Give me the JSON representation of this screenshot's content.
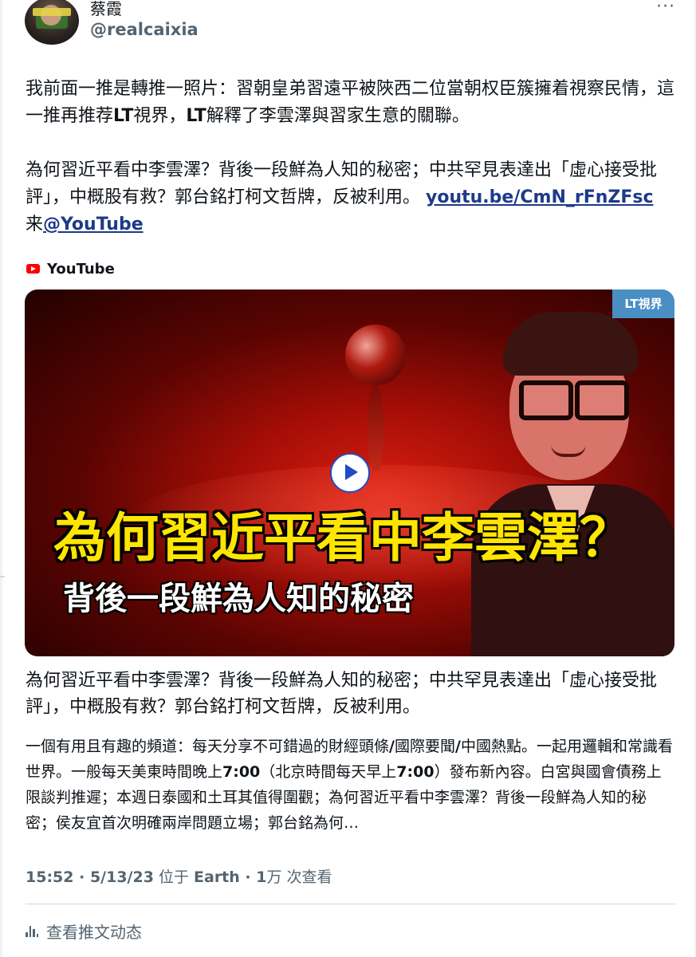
{
  "author": {
    "display_name": "蔡霞",
    "handle": "@realcaixia"
  },
  "more_icon": "more-horizontal-icon",
  "tweet": {
    "para1": [
      {
        "text": "我前面一推是轉推一照片：習朝皇弟習遠平被陜西二位當朝权臣簇擁着視察民情，這一推再推荐"
      },
      {
        "text": "LT",
        "bold": true
      },
      {
        "text": "視界，"
      },
      {
        "text": "LT",
        "bold": true
      },
      {
        "text": "解釋了李雲澤與習家生意的關聯。"
      }
    ],
    "para2_text": "為何習近平看中李雲澤？背後一段鮮為人知的秘密；中共罕見表達出「虛心接受批評」，中概股有救？郭台銘打柯文哲牌，反被利用。",
    "link_text": "youtu.be/CmN_rFnZFsc",
    "via_text": "来",
    "mention_text": "@YouTube"
  },
  "card": {
    "source_icon": "youtube-logo-icon",
    "source_label": "YouTube",
    "badge": "LT視界",
    "thumbnail_title": "為何習近平看中李雲澤？",
    "thumbnail_subtitle": "背後一段鮮為人知的秘密",
    "title": "為何習近平看中李雲澤？背後一段鮮為人知的秘密；中共罕見表達出「虛心接受批評」，中概股有救？郭台銘打柯文哲牌，反被利用。",
    "description": [
      {
        "text": "一個有用且有趣的頻道：每天分享不可錯過的財經頭條"
      },
      {
        "text": "/",
        "bold": true
      },
      {
        "text": "國際要聞"
      },
      {
        "text": "/",
        "bold": true
      },
      {
        "text": "中國熱點。一起用邏輯和常識看世界。一般每天美東時間晚上"
      },
      {
        "text": "7:00",
        "bold": true
      },
      {
        "text": "（北京時間每天早上"
      },
      {
        "text": "7:00",
        "bold": true
      },
      {
        "text": "）發布新內容。白宮與國會債務上限談判推遲；本週日泰國和土耳其值得圍觀；為何習近平看中李雲澤？背後一段鮮為人知的秘密；侯友宜首次明確兩岸問題立場；郭台銘為何…"
      }
    ]
  },
  "meta": {
    "time": "15:52",
    "sep1": " · ",
    "date": "5/13/23",
    "location_prefix": " 位于 ",
    "location": "Earth",
    "sep2": " · ",
    "views_count": "1",
    "views_unit": "万",
    "views_label": " 次查看"
  },
  "activity": {
    "icon": "analytics-bars-icon",
    "label": "查看推文动态"
  },
  "colors": {
    "link": "#1d3a8a",
    "secondary_text": "#536471",
    "youtube_red": "#ff0000",
    "thumbnail_title": "#ffe500"
  }
}
